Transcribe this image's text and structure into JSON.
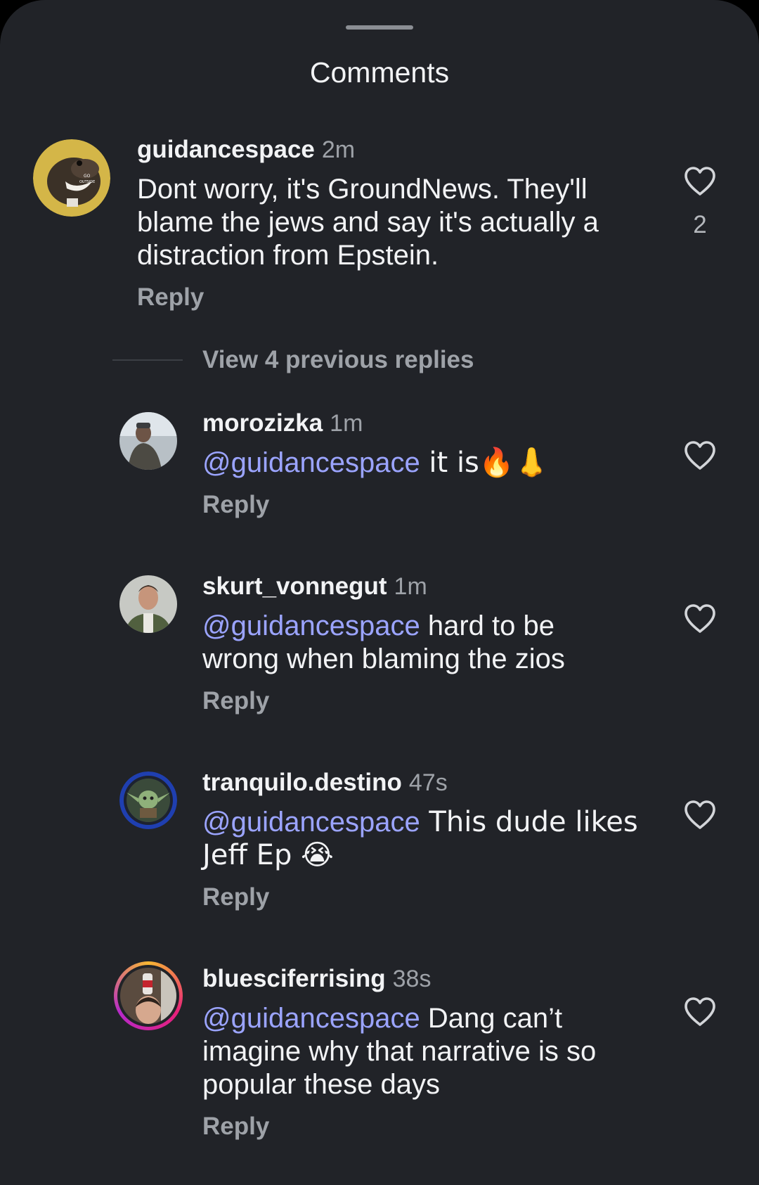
{
  "sheet": {
    "title": "Comments"
  },
  "comments": [
    {
      "username": "guidancespace",
      "time": "2m",
      "text": "Dont worry, it's GroundNews. They'll blame the jews and say it's actually a distraction from Epstein.",
      "reply_label": "Reply",
      "like_count": "2",
      "avatar_text": "GO OUTSIDE"
    }
  ],
  "view_replies": {
    "label": "View 4 previous replies"
  },
  "replies": [
    {
      "username": "morozizka",
      "time": "1m",
      "mention": "@guidancespace",
      "text": " it is🔥👃",
      "reply_label": "Reply"
    },
    {
      "username": "skurt_vonnegut",
      "time": "1m",
      "mention": "@guidancespace",
      "text": " hard to be wrong when blaming the zios",
      "reply_label": "Reply"
    },
    {
      "username": "tranquilo.destino",
      "time": "47s",
      "mention": "@guidancespace",
      "text": " This dude likes Jeff Ep 😭",
      "reply_label": "Reply"
    },
    {
      "username": "bluesciferrising",
      "time": "38s",
      "mention": "@guidancespace",
      "text": " Dang can’t imagine why that narrative is so popular these days",
      "reply_label": "Reply"
    }
  ],
  "colors": {
    "background": "#212328",
    "text": "#f2f3f5",
    "muted": "#9ea2a8",
    "mention": "#9ba4ff"
  },
  "icons": {
    "like": "heart-outline-icon",
    "drag": "drag-handle"
  }
}
